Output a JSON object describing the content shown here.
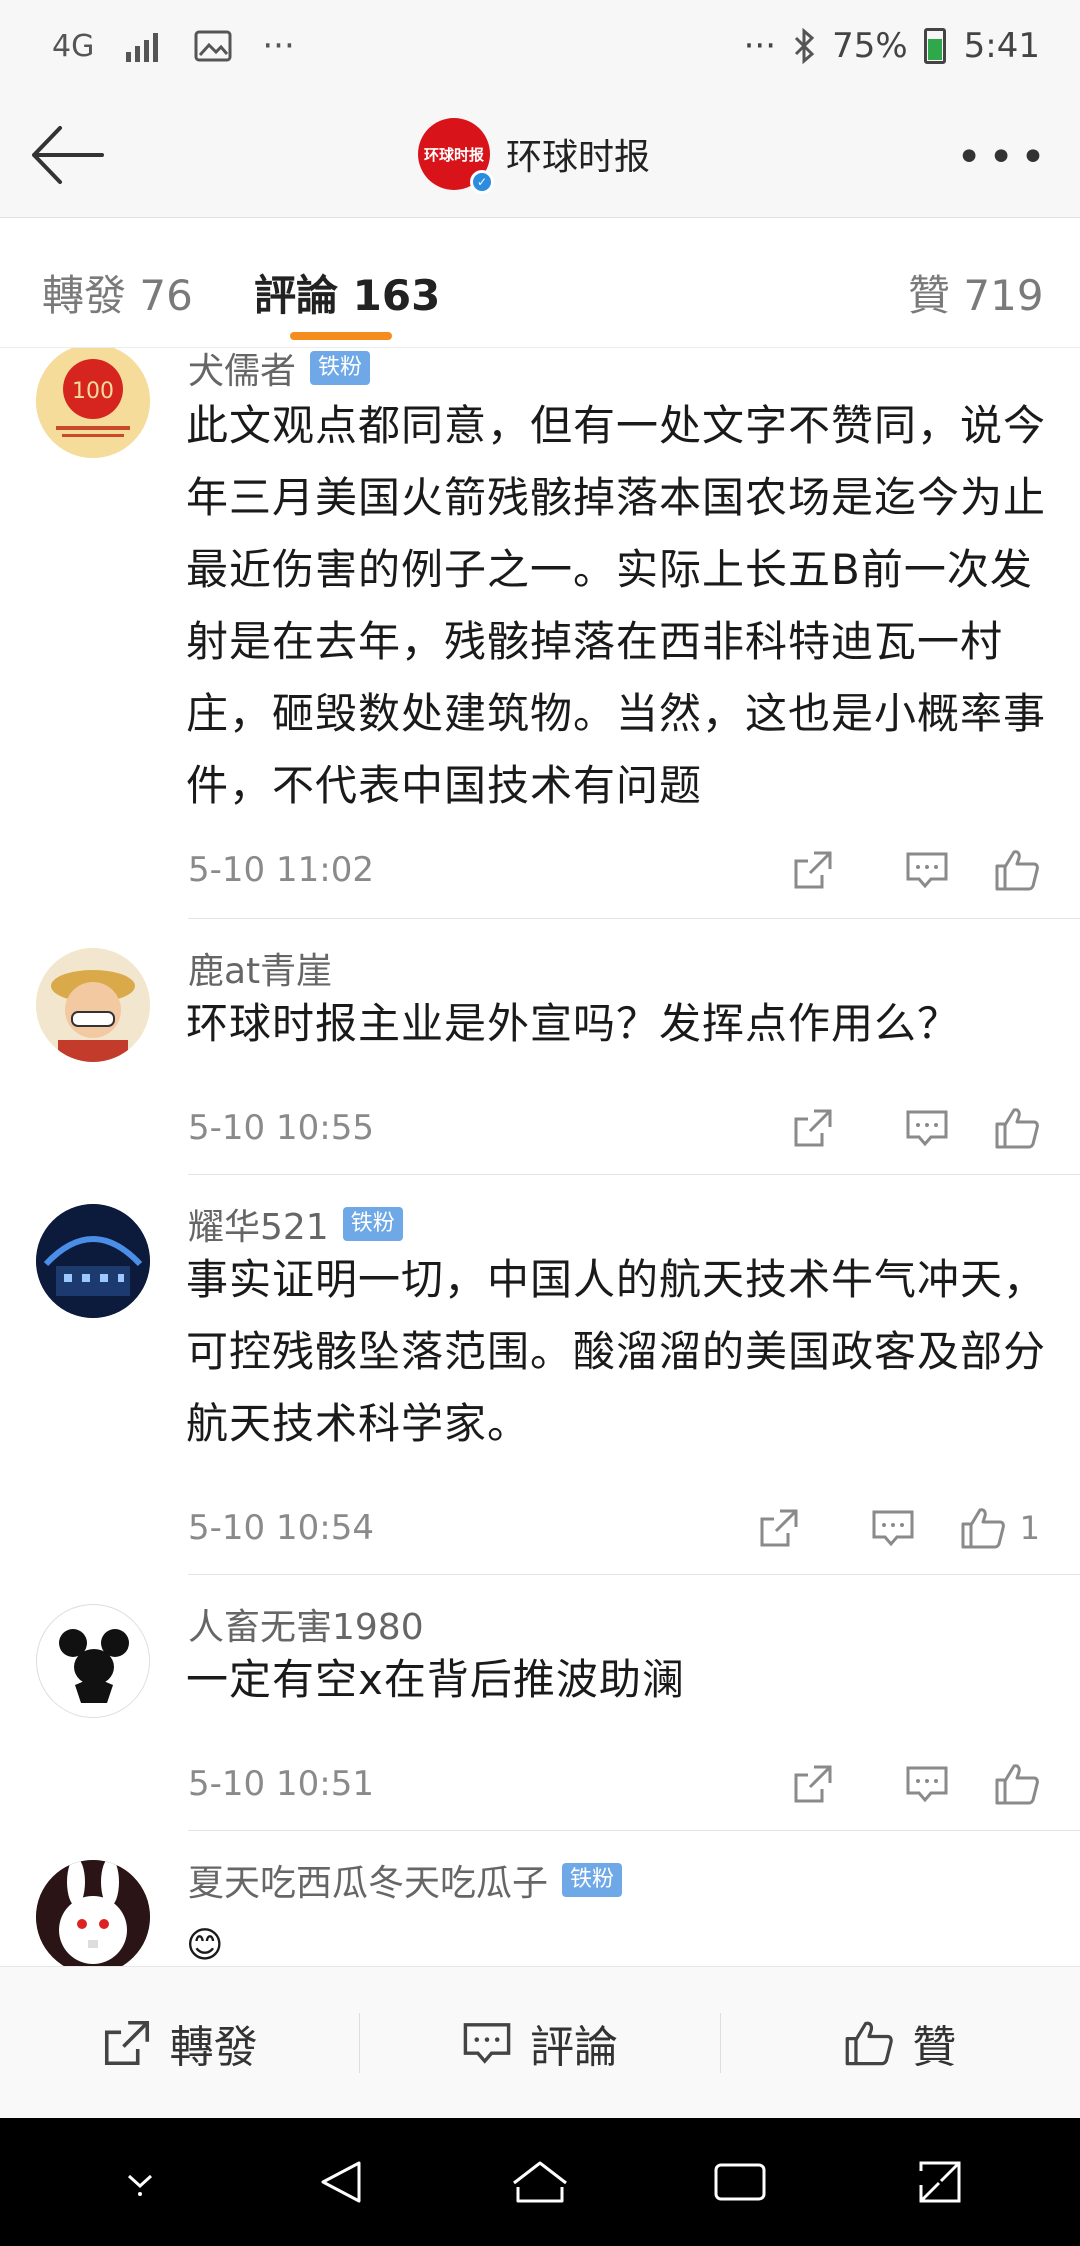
{
  "status": {
    "network": "4G",
    "more": "···",
    "right_more": "···",
    "battery": "75%",
    "time": "5:41"
  },
  "header": {
    "title": "环球时报",
    "logo_text": "环球时报"
  },
  "tabs": [
    {
      "label": "轉發",
      "count": "76"
    },
    {
      "label": "評論",
      "count": "163"
    },
    {
      "label": "贊",
      "count": "719"
    }
  ],
  "comments": [
    {
      "user": "犬儒者",
      "badge": "铁粉",
      "text": "此文观点都同意，但有一处文字不赞同，说今年三月美国火箭残骸掉落本国农场是迄今为止最近伤害的例子之一。实际上长五B前一次发射是在去年，残骸掉落在西非科特迪瓦一村庄，砸毁数处建筑物。当然，这也是小概率事件，不代表中国技术有问题",
      "time": "5-10 11:02",
      "likes": ""
    },
    {
      "user": "鹿at青崖",
      "badge": "",
      "text": "环球时报主业是外宣吗？发挥点作用么？",
      "time": "5-10 10:55",
      "likes": ""
    },
    {
      "user": "耀华521",
      "badge": "铁粉",
      "text": "事实证明一切，中国人的航天技术牛气冲天，可控残骸坠落范围。酸溜溜的美国政客及部分航天技术科学家。",
      "time": "5-10 10:54",
      "likes": "1"
    },
    {
      "user": "人畜无害1980",
      "badge": "",
      "text": "一定有空x在背后推波助澜",
      "time": "5-10 10:51",
      "likes": ""
    },
    {
      "user": "夏天吃西瓜冬天吃瓜子",
      "badge": "铁粉",
      "text": "😊",
      "time": "",
      "likes": ""
    }
  ],
  "bottom_actions": {
    "repost": "轉發",
    "comment": "評論",
    "like": "贊"
  },
  "colors": {
    "accent": "#f58c1e",
    "badge": "#6fa8e6",
    "brand_red": "#d8141a"
  }
}
